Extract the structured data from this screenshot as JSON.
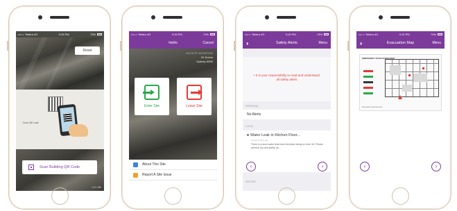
{
  "phones": {
    "p1": {
      "status": {
        "carrier": "•••○○ Telstra 4G",
        "time": "9:15 PM",
        "battery": "73%"
      },
      "reset_label": "Reset",
      "scan_caption": "Scan QR code",
      "scan_button_label": "Scan Building QR Code",
      "version": "v1.0.180"
    },
    "p2": {
      "status": {
        "carrier": "•••○○ Telstra 4G",
        "time": "9:15 PM",
        "battery": "74%"
      },
      "nav": {
        "title": "Hello",
        "right": "Cancel"
      },
      "site_info": {
        "line1": "ON-SITE VISITATION",
        "line2": "51 Drives",
        "line3": "Sydney NSW"
      },
      "enter_label": "Enter Site",
      "leave_label": "Leave Site",
      "menu": [
        {
          "label": "About This Site",
          "icon": "info-icon"
        },
        {
          "label": "Report A Site Issue",
          "icon": "report-icon"
        }
      ]
    },
    "p3": {
      "status": {
        "carrier": "•••○○ Telstra 4G",
        "time": "9:15 PM",
        "battery": "74%"
      },
      "nav": {
        "title": "Safety Alerts",
        "right": "Menu"
      },
      "warning": "• It is your responsibility to read and understand all safety alerts",
      "section_personal": "PERSONAL",
      "no_alerts": "No Alerts",
      "section_local": "LOCAL",
      "alert_title": "Water Leak in Kitchen Floor...",
      "alert_meta": "Posted 3 days ago",
      "alert_desc": "There is a slow water leak near electrical wiring on level 15. Please perform dry and safety as...",
      "section_history": "HISTORY"
    },
    "p4": {
      "status": {
        "carrier": "•••○○ Telstra 4G",
        "time": "9:15 PM",
        "battery": "74%"
      },
      "nav": {
        "title": "Evacuation Map",
        "right": "Menu"
      },
      "map_title": "EMERGENCY EVACUATION MAP",
      "map_footer": "Evacuation assembly area"
    }
  },
  "colors": {
    "brand": "#7c3a9a",
    "enter": "#2aa84a",
    "leave": "#e53935"
  }
}
